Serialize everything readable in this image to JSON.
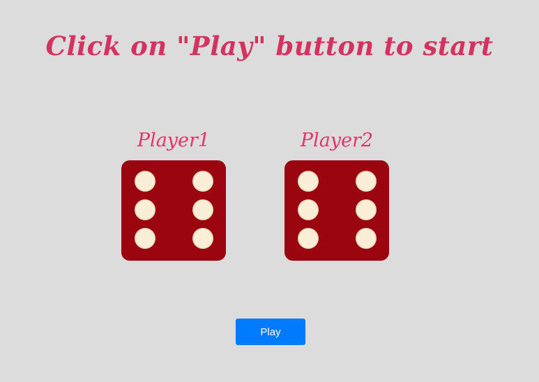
{
  "headline": "Click on \"Play\" button to start",
  "players": [
    {
      "name": "Player1",
      "die_value": 6
    },
    {
      "name": "Player2",
      "die_value": 6
    }
  ],
  "play_button": {
    "label": "Play"
  },
  "colors": {
    "background": "#dcdcdc",
    "headline": "#d6325f",
    "player_name": "#e8306a",
    "die_face": "#9b050f",
    "die_pip": "#faefd6",
    "button": "#007bff"
  }
}
